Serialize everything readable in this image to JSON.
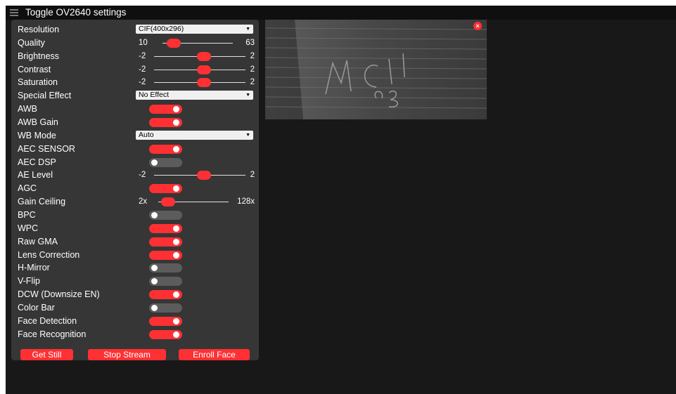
{
  "window": {
    "title": "Toggle OV2640 settings"
  },
  "settings": {
    "resolution": {
      "label": "Resolution",
      "value": "CIF(400x296)"
    },
    "quality": {
      "label": "Quality",
      "min": "10",
      "max": "63",
      "value": 10
    },
    "brightness": {
      "label": "Brightness",
      "min": "-2",
      "max": "2",
      "value": 0
    },
    "contrast": {
      "label": "Contrast",
      "min": "-2",
      "max": "2",
      "value": 0
    },
    "saturation": {
      "label": "Saturation",
      "min": "-2",
      "max": "2",
      "value": 0
    },
    "special_effect": {
      "label": "Special Effect",
      "value": "No Effect"
    },
    "awb": {
      "label": "AWB",
      "on": true
    },
    "awb_gain": {
      "label": "AWB Gain",
      "on": true
    },
    "wb_mode": {
      "label": "WB Mode",
      "value": "Auto"
    },
    "aec_sensor": {
      "label": "AEC SENSOR",
      "on": true
    },
    "aec_dsp": {
      "label": "AEC DSP",
      "on": false
    },
    "ae_level": {
      "label": "AE Level",
      "min": "-2",
      "max": "2",
      "value": 0
    },
    "agc": {
      "label": "AGC",
      "on": true
    },
    "gain_ceiling": {
      "label": "Gain Ceiling",
      "min": "2x",
      "max": "128x",
      "value": 0
    },
    "bpc": {
      "label": "BPC",
      "on": false
    },
    "wpc": {
      "label": "WPC",
      "on": true
    },
    "raw_gma": {
      "label": "Raw GMA",
      "on": true
    },
    "lens_correction": {
      "label": "Lens Correction",
      "on": true
    },
    "h_mirror": {
      "label": "H-Mirror",
      "on": false
    },
    "v_flip": {
      "label": "V-Flip",
      "on": false
    },
    "dcw": {
      "label": "DCW (Downsize EN)",
      "on": true
    },
    "color_bar": {
      "label": "Color Bar",
      "on": false
    },
    "face_detection": {
      "label": "Face Detection",
      "on": true
    },
    "face_recognition": {
      "label": "Face Recognition",
      "on": true
    }
  },
  "buttons": {
    "get_still": "Get Still",
    "stop_stream": "Stop Stream",
    "enroll_face": "Enroll Face"
  },
  "preview": {
    "close_glyph": "×"
  },
  "colors": {
    "accent": "#ff3034",
    "panel": "#363636",
    "background": "#181818",
    "toggle_off": "#5c5c5c"
  },
  "icons": {
    "menu": "hamburger-menu-icon",
    "close": "close-icon"
  }
}
